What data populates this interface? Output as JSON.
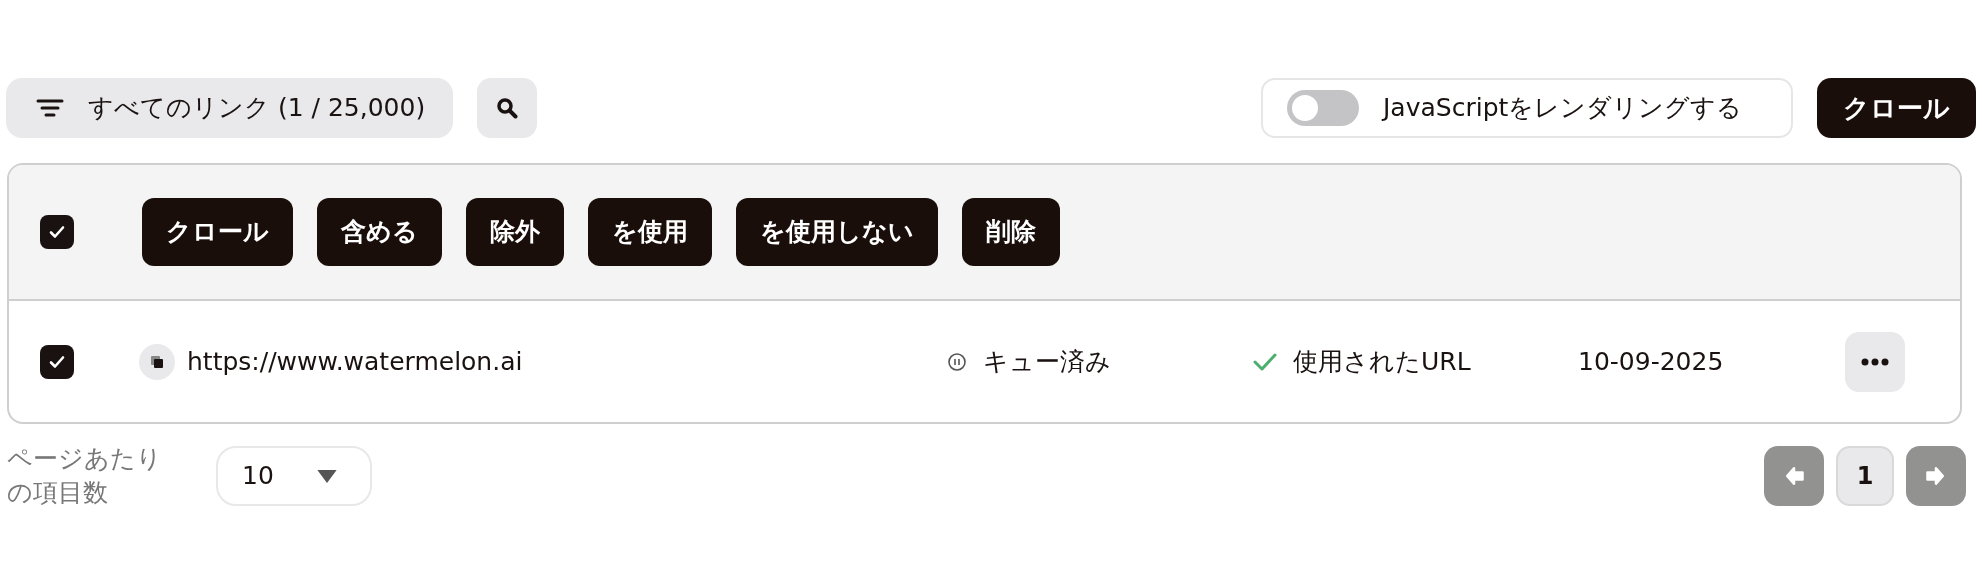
{
  "toolbar": {
    "filter_label": "すべてのリンク (1 / 25,000)",
    "render_toggle": {
      "label": "JavaScriptをレンダリングする",
      "on": false
    },
    "crawl_button": "クロール"
  },
  "table": {
    "select_all_checked": true,
    "bulk_actions": [
      "クロール",
      "含める",
      "除外",
      "を使用",
      "を使用しない",
      "削除"
    ],
    "rows": [
      {
        "checked": true,
        "url": "https://www.watermelon.ai",
        "status": "キュー済み",
        "usage": "使用されたURL",
        "date": "10-09-2025"
      }
    ]
  },
  "pagination": {
    "per_page_label": "ページあたりの項目数",
    "per_page": "10",
    "prev_disabled": true,
    "next_disabled": true,
    "pages": [
      {
        "label": "1",
        "selected": true
      }
    ]
  }
}
